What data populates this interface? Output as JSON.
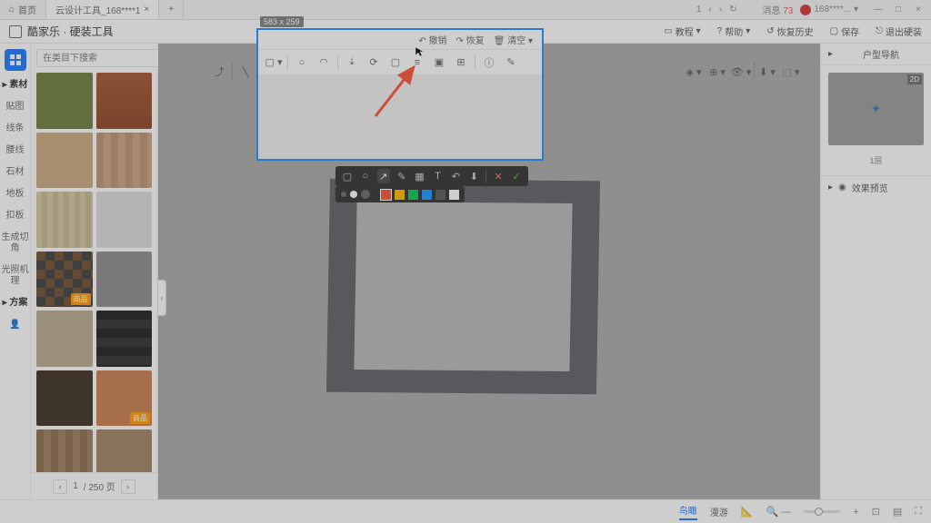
{
  "window": {
    "tab1": "首页",
    "tab2": "云设计工具_168****1",
    "nav_count": "1",
    "msg_label": "消息",
    "msg_count": "73",
    "user": "168****..."
  },
  "app": {
    "title": "酷家乐 · 硬装工具",
    "menu": {
      "tutorial": "教程",
      "help": "帮助",
      "history": "恢复历史",
      "save": "保存",
      "export": "退出硬装"
    }
  },
  "left": {
    "search_placeholder": "在类目下搜索",
    "cats": [
      "素材",
      "贴图",
      "线条",
      "腰线",
      "石材",
      "地板",
      "扣板",
      "生成切角",
      "光照机理",
      "方案"
    ],
    "badge": "商品",
    "page_current": "1",
    "page_total": "/ 250 页"
  },
  "popup": {
    "dimensions": "583 x 259",
    "undo": "撤销",
    "redo": "恢复",
    "clear": "清空"
  },
  "right": {
    "nav_title": "户型导航",
    "tag2d": "2D",
    "floor": "1层",
    "preview_title": "效果预览"
  },
  "bottom": {
    "view1": "鸟瞰",
    "view2": "漫游"
  },
  "colors": {
    "swatches": [
      "#6b7a3a",
      "#a0522d",
      "#8b8b8b",
      "#c9a87c",
      "#b89070",
      "#d4c8a0",
      "#dcdcdc",
      "#3a3a3a",
      "#6b4a2a",
      "#3a2a1a",
      "#3a2a1a",
      "#c97a4a",
      "#8b6a4a",
      "#a08060"
    ],
    "annot_colors": [
      "#ff4d2e",
      "#ffb800",
      "#00c853",
      "#1890ff",
      "#7b1fa2",
      "#ffffff"
    ]
  }
}
